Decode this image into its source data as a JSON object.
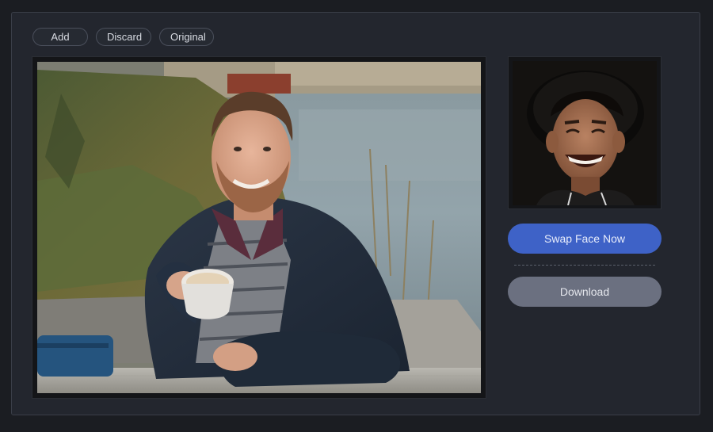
{
  "toolbar": {
    "add_label": "Add",
    "discard_label": "Discard",
    "original_label": "Original"
  },
  "main_image": {
    "subject": "man-holding-coffee-cup-by-water"
  },
  "face_image": {
    "subject": "smiling-man-wearing-hat"
  },
  "actions": {
    "swap_label": "Swap Face Now",
    "download_label": "Download"
  },
  "colors": {
    "background": "#1b1d22",
    "panel": "#23262e",
    "accent": "#3e62c7",
    "secondary_button": "#6b7080"
  }
}
